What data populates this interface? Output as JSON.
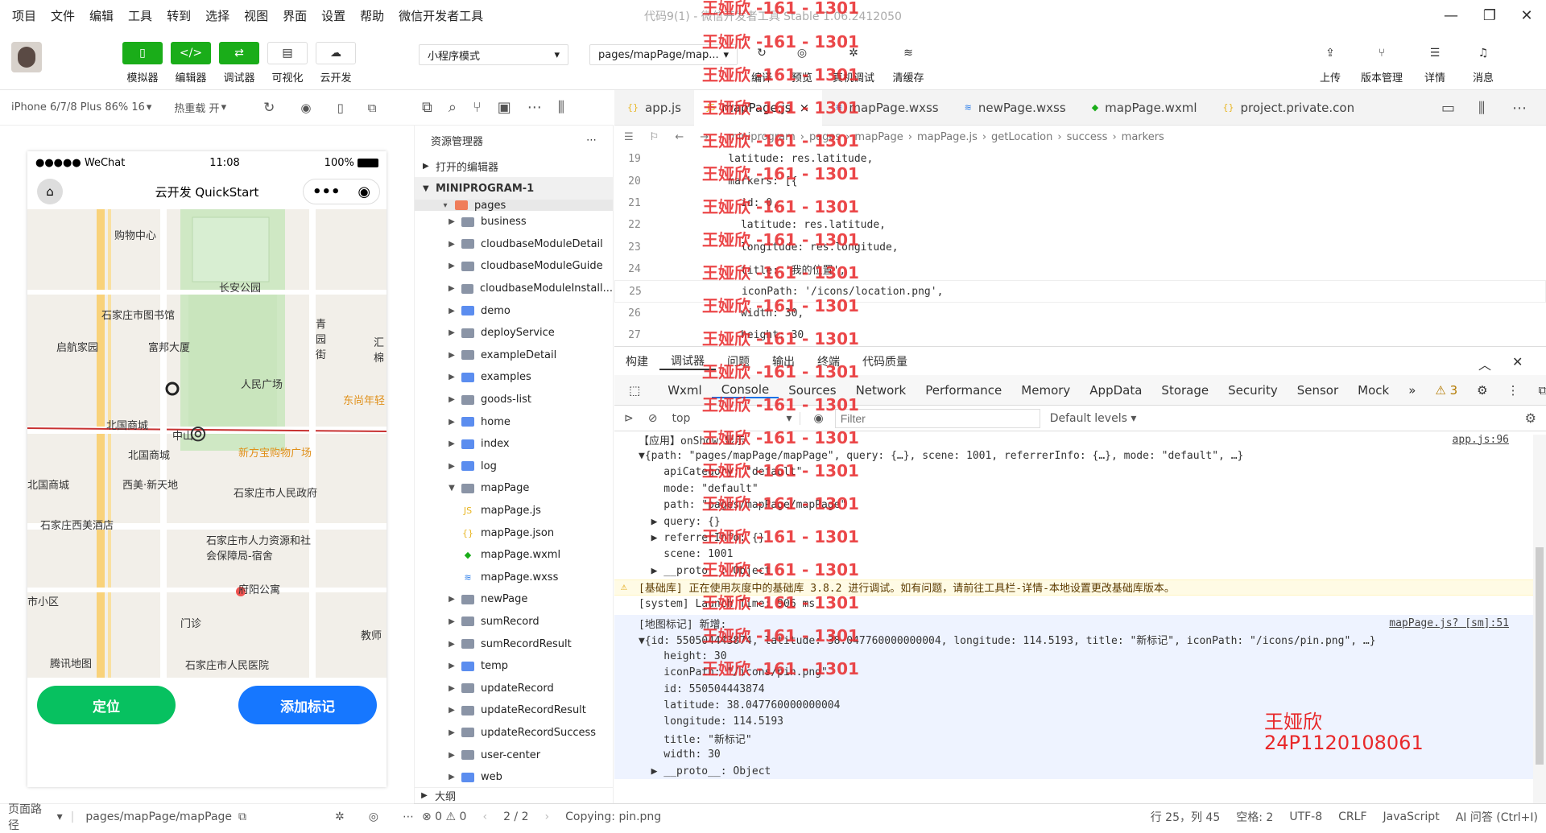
{
  "menu": [
    "项目",
    "文件",
    "编辑",
    "工具",
    "转到",
    "选择",
    "视图",
    "界面",
    "设置",
    "帮助",
    "微信开发者工具"
  ],
  "window_title": "代码9(1) - 微信开发者工具 Stable 1.06.2412050",
  "toolbar": {
    "left": [
      {
        "label": "模拟器",
        "icon": "phone-icon"
      },
      {
        "label": "编辑器",
        "icon": "code-icon"
      },
      {
        "label": "调试器",
        "icon": "debug-icon"
      },
      {
        "label": "可视化",
        "icon": "layout-icon"
      },
      {
        "label": "云开发",
        "icon": "cloud-icon"
      }
    ],
    "mode_select": "小程序模式",
    "page_select": "pages/mapPage/map...",
    "mid": [
      {
        "label": "编译",
        "icon": "refresh-icon"
      },
      {
        "label": "预览",
        "icon": "eye-icon"
      },
      {
        "label": "真机调试",
        "icon": "bug-icon"
      },
      {
        "label": "清缓存",
        "icon": "layers-icon"
      }
    ],
    "right": [
      {
        "label": "上传",
        "icon": "upload-icon"
      },
      {
        "label": "版本管理",
        "icon": "branch-icon"
      },
      {
        "label": "详情",
        "icon": "menu-icon"
      },
      {
        "label": "消息",
        "icon": "bell-icon"
      }
    ]
  },
  "simulator": {
    "device": "iPhone 6/7/8 Plus 86% 16",
    "hotreload": "热重载 开",
    "status_left": "●●●●● WeChat",
    "status_time": "11:08",
    "status_right": "100%",
    "nav_title": "云开发 QuickStart",
    "map_labels": [
      "购物中心",
      "长安公园",
      "石家庄市图书馆",
      "启航家园",
      "富邦大厦",
      "人民广场",
      "东尚年轻",
      "北国商城",
      "中山",
      "新方宝购物广场",
      "北国商城",
      "西美·新天地",
      "北国商城",
      "石家庄市人民政府",
      "石家庄西美酒店",
      "石家庄市人力资源和社会保障局-宿舍",
      "府阳公寓",
      "门诊",
      "青园街",
      "汇棉",
      "市小区",
      "教师",
      "腾讯地图",
      "石家庄市人民医院"
    ],
    "btn_locate": "定位",
    "btn_add": "添加标记",
    "footer_path_label": "页面路径",
    "footer_path": "pages/mapPage/mapPage"
  },
  "explorer": {
    "title": "资源管理器",
    "sec_open": "打开的编辑器",
    "sec_project": "MINIPROGRAM-1",
    "pages_label": "pages",
    "items": [
      {
        "name": "business",
        "type": "folder"
      },
      {
        "name": "cloudbaseModuleDetail",
        "type": "folder"
      },
      {
        "name": "cloudbaseModuleGuide",
        "type": "folder"
      },
      {
        "name": "cloudbaseModuleInstall...",
        "type": "folder"
      },
      {
        "name": "demo",
        "type": "folder"
      },
      {
        "name": "deployService",
        "type": "folder"
      },
      {
        "name": "exampleDetail",
        "type": "folder"
      },
      {
        "name": "examples",
        "type": "folder"
      },
      {
        "name": "goods-list",
        "type": "folder"
      },
      {
        "name": "home",
        "type": "folder"
      },
      {
        "name": "index",
        "type": "folder"
      },
      {
        "name": "log",
        "type": "folder"
      },
      {
        "name": "mapPage",
        "type": "folder-open"
      },
      {
        "name": "mapPage.js",
        "type": "js"
      },
      {
        "name": "mapPage.json",
        "type": "json"
      },
      {
        "name": "mapPage.wxml",
        "type": "wxml"
      },
      {
        "name": "mapPage.wxss",
        "type": "wxss"
      },
      {
        "name": "newPage",
        "type": "folder"
      },
      {
        "name": "sumRecord",
        "type": "folder"
      },
      {
        "name": "sumRecordResult",
        "type": "folder"
      },
      {
        "name": "temp",
        "type": "folder"
      },
      {
        "name": "updateRecord",
        "type": "folder"
      },
      {
        "name": "updateRecordResult",
        "type": "folder"
      },
      {
        "name": "updateRecordSuccess",
        "type": "folder"
      },
      {
        "name": "user-center",
        "type": "folder"
      },
      {
        "name": "web",
        "type": "folder"
      }
    ],
    "outline": "大纲"
  },
  "editor": {
    "tabs": [
      {
        "name": "app.js",
        "icon": "{}"
      },
      {
        "name": "mapPage.js",
        "icon": "JS"
      },
      {
        "name": "mapPage.wxss",
        "icon": "≋"
      },
      {
        "name": "newPage.wxss",
        "icon": "≋"
      },
      {
        "name": "mapPage.wxml",
        "icon": "◆"
      },
      {
        "name": "project.private.con",
        "icon": "{}"
      }
    ],
    "breadcrumbs": [
      "miniprogram",
      "pages",
      "mapPage",
      "mapPage.js",
      "getLocation",
      "success",
      "markers"
    ],
    "lines": [
      {
        "n": "19",
        "t": "    latitude: res.latitude,"
      },
      {
        "n": "20",
        "t": "    markers: [{"
      },
      {
        "n": "21",
        "t": "      id: 0,"
      },
      {
        "n": "22",
        "t": "      latitude: res.latitude,"
      },
      {
        "n": "23",
        "t": "      longitude: res.longitude,"
      },
      {
        "n": "24",
        "t": "      title: '我的位置',"
      },
      {
        "n": "25",
        "t": "      iconPath: '/icons/location.png',"
      },
      {
        "n": "26",
        "t": "      width: 30,"
      },
      {
        "n": "27",
        "t": "      height: 30"
      }
    ]
  },
  "devtools": {
    "tabs": [
      "构建",
      "调试器",
      "问题",
      "输出",
      "终端",
      "代码质量"
    ],
    "panel_tabs": [
      "Wxml",
      "Console",
      "Sources",
      "Network",
      "Performance",
      "Memory",
      "AppData",
      "Storage",
      "Security",
      "Sensor",
      "Mock"
    ],
    "warn_count": "3",
    "context": "top",
    "filter_placeholder": "Filter",
    "levels": "Default levels",
    "console": [
      {
        "t": "【应用】onShow 显示",
        "src": "app.js:96",
        "cls": ""
      },
      {
        "t": "▼{path: \"pages/mapPage/mapPage\", query: {…}, scene: 1001, referrerInfo: {…}, mode: \"default\", …}",
        "cls": ""
      },
      {
        "t": "    apiCategory: \"default\"",
        "cls": ""
      },
      {
        "t": "    mode: \"default\"",
        "cls": ""
      },
      {
        "t": "    path: \"pages/mapPage/mapPage\"",
        "cls": ""
      },
      {
        "t": "  ▶ query: {}",
        "cls": ""
      },
      {
        "t": "  ▶ referrerInfo: {}",
        "cls": ""
      },
      {
        "t": "    scene: 1001",
        "cls": ""
      },
      {
        "t": "  ▶ __proto__: Object",
        "cls": ""
      },
      {
        "t": "[基础库] 正在使用灰度中的基础库 3.8.2 进行调试。如有问题，请前往工具栏-详情-本地设置更改基础库版本。",
        "cls": "warn"
      },
      {
        "t": "[system] Launch Time: 906 ms",
        "cls": ""
      },
      {
        "t": "[地图标记] 新增:",
        "src": "mapPage.js? [sm]:51",
        "cls": "sel"
      },
      {
        "t": "▼{id: 550504443874, latitude: 38.047760000000004, longitude: 114.5193, title: \"新标记\", iconPath: \"/icons/pin.png\", …}",
        "cls": "sel"
      },
      {
        "t": "    height: 30",
        "cls": "sel"
      },
      {
        "t": "    iconPath: \"/icons/pin.png\"",
        "cls": "sel"
      },
      {
        "t": "    id: 550504443874",
        "cls": "sel"
      },
      {
        "t": "    latitude: 38.047760000000004",
        "cls": "sel"
      },
      {
        "t": "    longitude: 114.5193",
        "cls": "sel"
      },
      {
        "t": "    title: \"新标记\"",
        "cls": "sel"
      },
      {
        "t": "    width: 30",
        "cls": "sel"
      },
      {
        "t": "  ▶ __proto__: Object",
        "cls": "sel"
      }
    ]
  },
  "statusbar": {
    "errors": "⊗ 0 ⚠ 0",
    "pager": "2 / 2",
    "message": "Copying: pin.png",
    "position": "行 25，列 45",
    "spaces": "空格: 2",
    "encoding": "UTF-8",
    "eol": "CRLF",
    "lang": "JavaScript",
    "ai": "AI 问答 (Ctrl+I)"
  },
  "watermark": "王娅欣 -161 - 1301",
  "student_name": "王娅欣",
  "student_id": "24P1120108061",
  "colors": {
    "green": "#1aad19",
    "locate_btn": "#07c160",
    "add_btn": "#1677ff",
    "watermark": "#e8282a"
  }
}
